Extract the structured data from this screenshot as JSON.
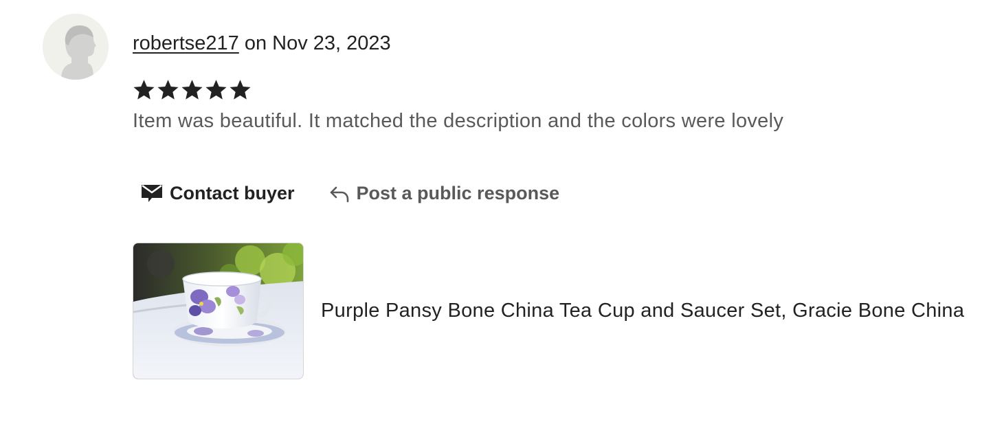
{
  "review": {
    "username": "robertse217",
    "date_text": " on Nov 23, 2023",
    "rating": 5,
    "max_rating": 5,
    "text": "Item was beautiful. It matched the description and the colors were lovely"
  },
  "actions": {
    "contact_label": "Contact buyer",
    "respond_label": "Post a public response"
  },
  "listing": {
    "title": "Purple Pansy Bone China Tea Cup and Saucer Set, Gracie Bone China"
  },
  "icons": {
    "avatar": "default-avatar-icon",
    "star": "star-icon",
    "contact": "envelope-icon",
    "respond": "reply-arrow-icon"
  },
  "colors": {
    "text_primary": "#222222",
    "text_secondary": "#595959",
    "avatar_bg": "#f1f1ec",
    "star": "#222222"
  }
}
